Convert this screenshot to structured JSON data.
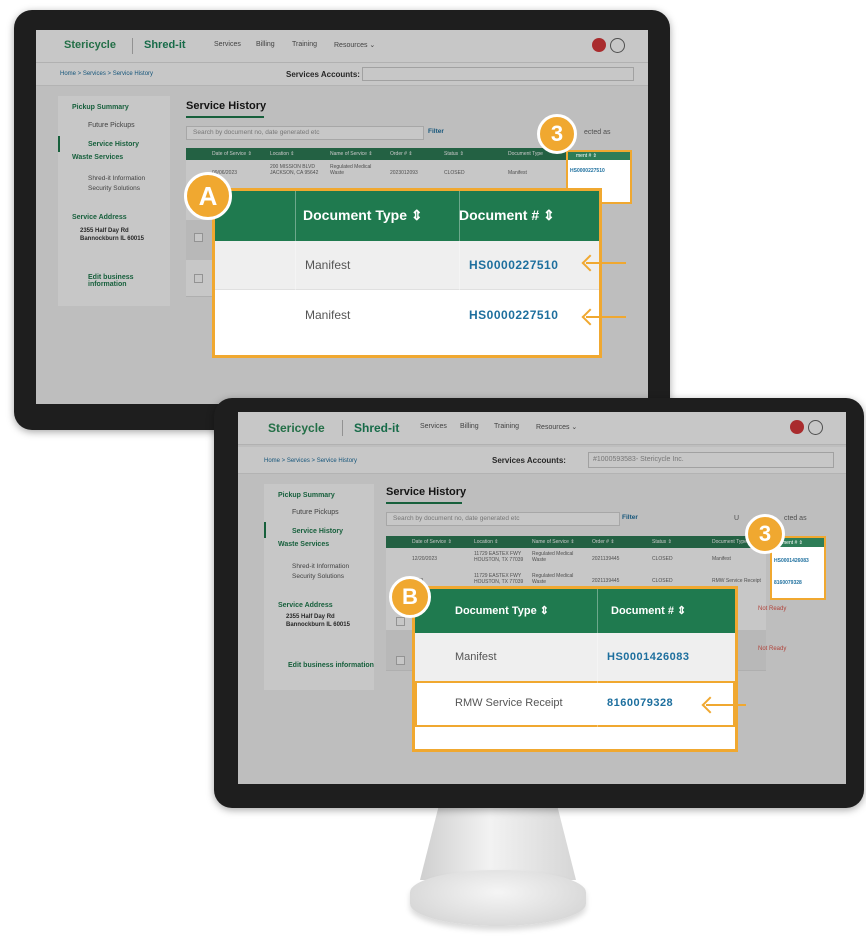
{
  "brand": {
    "stericycle": "Stericycle",
    "shredit": "Shred-it"
  },
  "nav": {
    "services": "Services",
    "billing": "Billing",
    "training": "Training",
    "resources": "Resources ⌄"
  },
  "breadcrumb": "Home > Services > Service History",
  "accounts": {
    "label": "Services Accounts:",
    "value_top": "",
    "value_bottom": "#1000593583- Stericycle Inc."
  },
  "sidebar": {
    "pickup_summary": "Pickup Summary",
    "future_pickups": "Future Pickups",
    "service_history": "Service History",
    "waste_services": "Waste Services",
    "shredit_info": "Shred-it Information",
    "security_solutions": "Security Solutions",
    "service_address": "Service Address",
    "address_line1": "2355 Half Day Rd",
    "address_line2": "Bannockburn IL 60015",
    "edit_business": "Edit business information"
  },
  "page_title": "Service History",
  "search_placeholder_top": "Search by document no, date generated etc",
  "search_placeholder_bottom": "Search by document no, date generated etc",
  "filter": "Filter",
  "selected_as_top": "ected as",
  "selected_as_bottom": "cted as",
  "updated_prefix": "U",
  "columns": {
    "date": "Date of Service ⇕",
    "location": "Location ⇕",
    "name": "Name of Service ⇕",
    "order": "Order # ⇕",
    "status": "Status ⇕",
    "doc_type": "Document Type",
    "doc_num": "ment # ⇕"
  },
  "top_table": {
    "rows": [
      {
        "date": "09/06/2023",
        "location": "200 MISSION BLVD JACKSON, CA 95642",
        "name": "Regulated Medical Waste",
        "order": "2023012093",
        "status": "CLOSED",
        "doc_type": "Manifest",
        "doc_num": "HS0000227510"
      }
    ],
    "right_extra": "10"
  },
  "bottom_table": {
    "rows": [
      {
        "date": "12/20/2023",
        "location": "11729 EASTEX FWY HOUSTON, TX 77039",
        "name": "Regulated Medical Waste",
        "order": "2021139445",
        "status": "CLOSED",
        "doc_type": "Manifest",
        "doc_num": "HS0001426083"
      },
      {
        "date": "2023",
        "location": "11729 EASTEX FWY HOUSTON, TX 77039",
        "name": "Regulated Medical Waste",
        "order": "2021139445",
        "status": "CLOSED",
        "doc_type": "RMW Service Receipt",
        "doc_num": "8160079328"
      }
    ],
    "not_ready": "Not Ready"
  },
  "zoom_a": {
    "letter": "A",
    "header_type": "Document Type ⇕",
    "header_num": "Document # ⇕",
    "rows": [
      {
        "type": "Manifest",
        "num": "HS0000227510"
      },
      {
        "type": "Manifest",
        "num": "HS0000227510"
      }
    ]
  },
  "zoom_b": {
    "letter": "B",
    "header_type": "Document Type ⇕",
    "header_num": "Document # ⇕",
    "rows": [
      {
        "type": "Manifest",
        "num": "HS0001426083"
      },
      {
        "type": "RMW Service Receipt",
        "num": "8160079328"
      }
    ]
  },
  "step_badge": "3",
  "colors": {
    "green": "#1f7a4f",
    "accent": "#f0a830",
    "link": "#1d6f9e"
  }
}
